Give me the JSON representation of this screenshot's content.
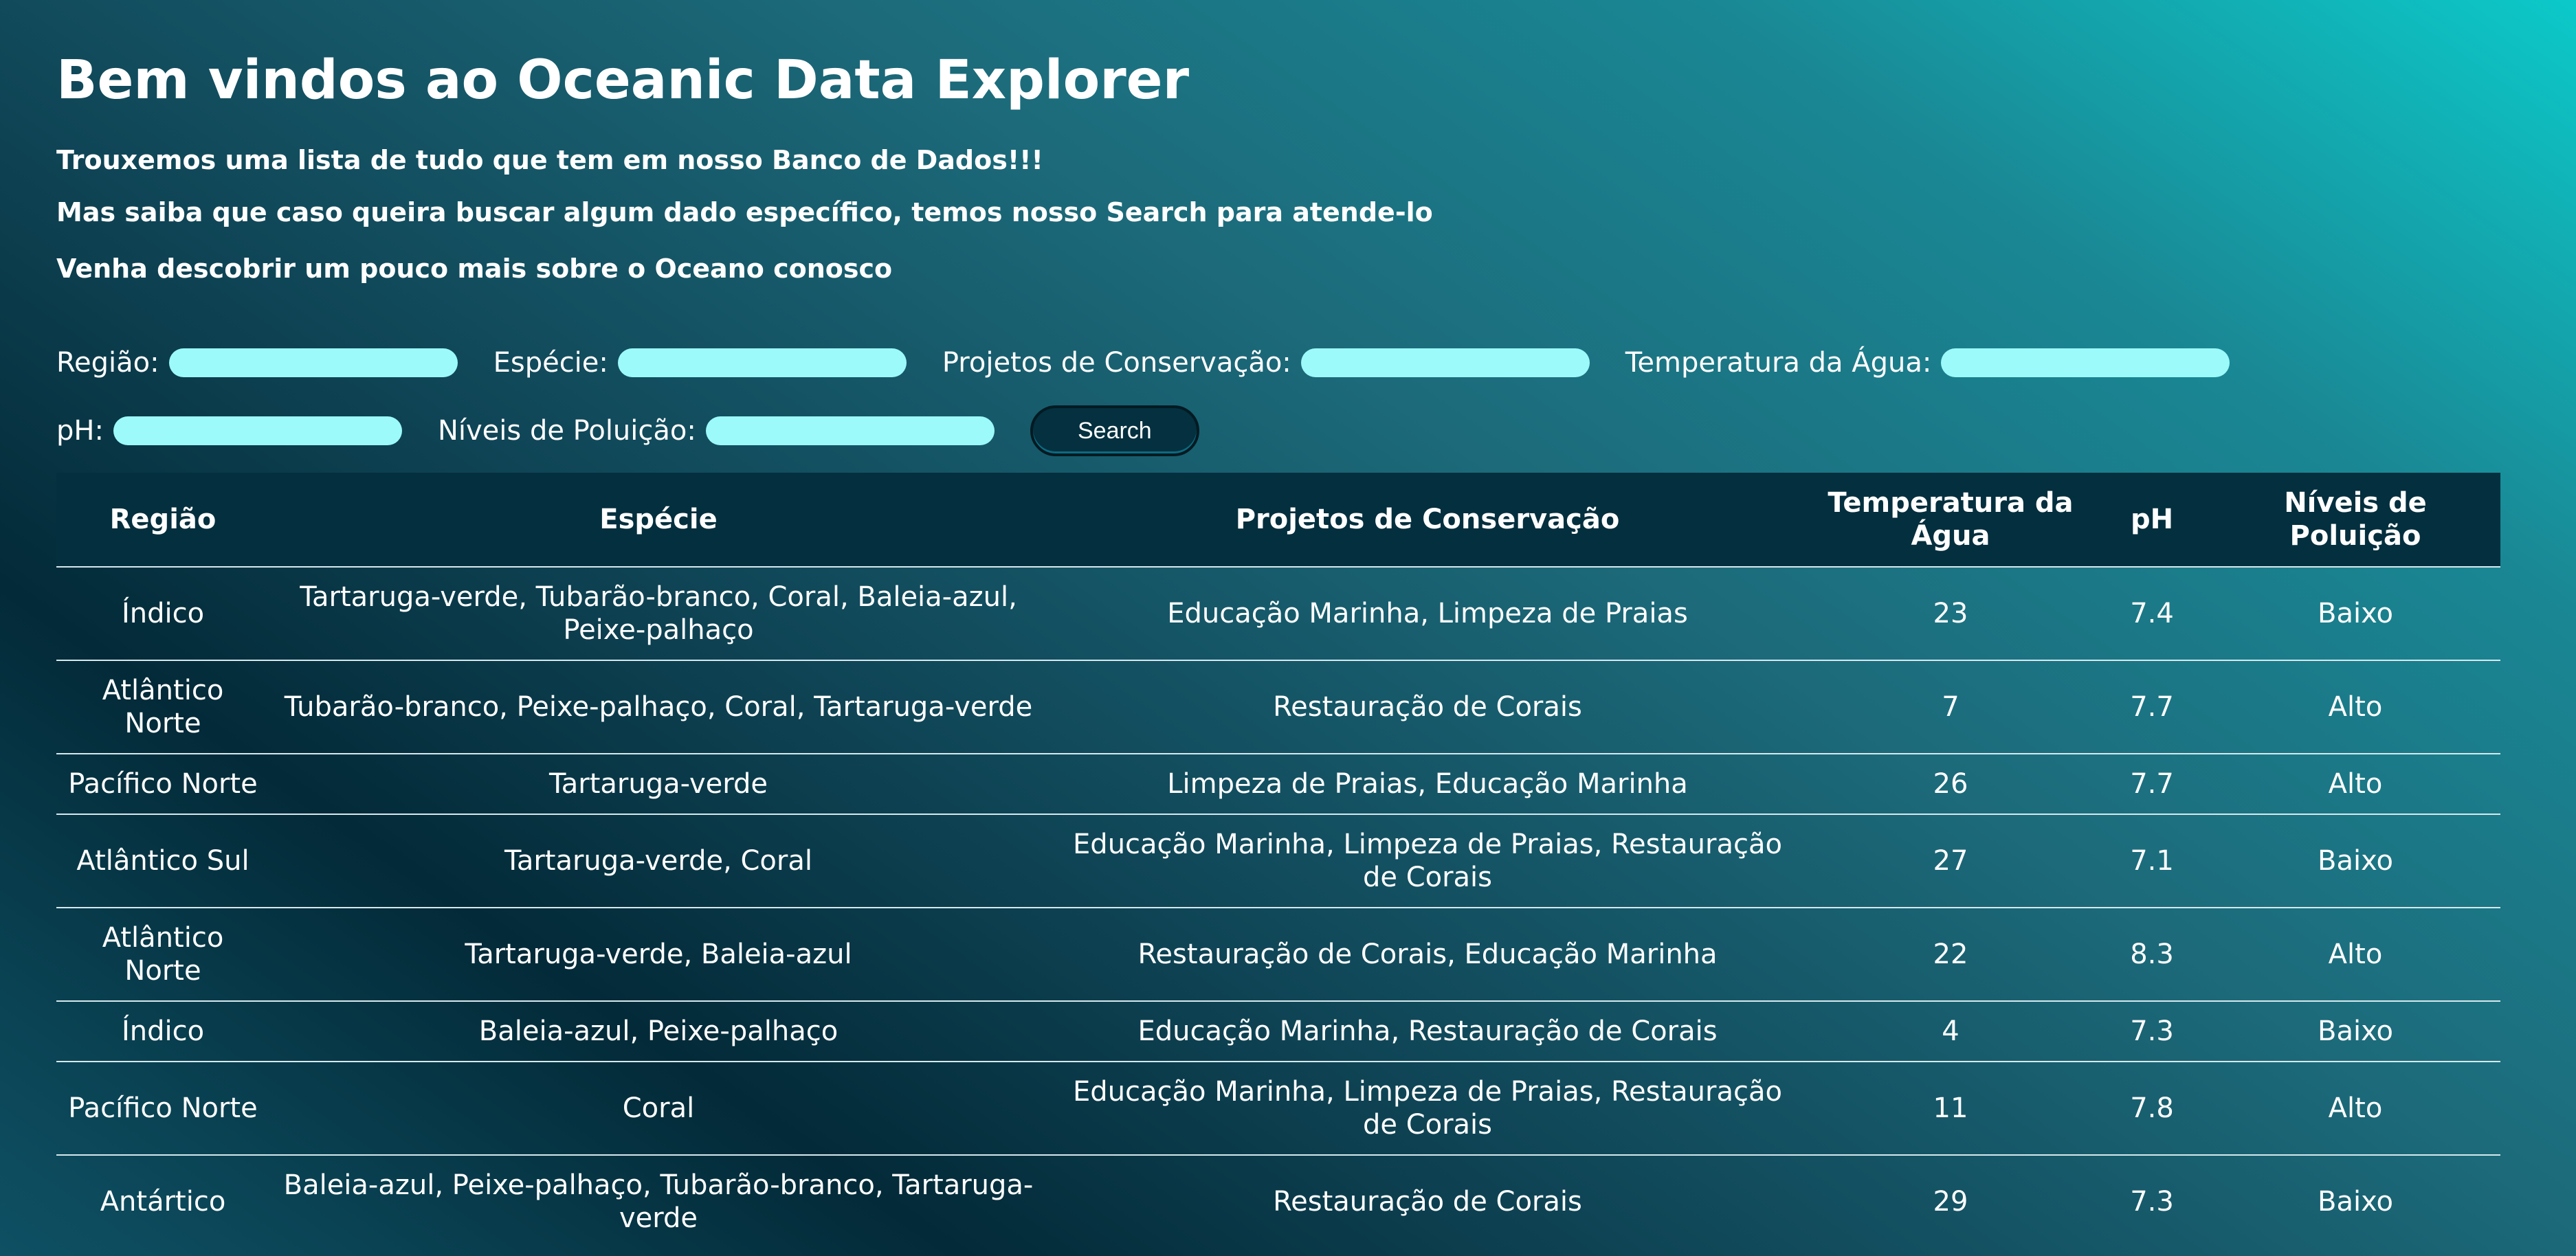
{
  "page": {
    "title": "Bem vindos ao Oceanic Data Explorer",
    "intro": [
      "Trouxemos uma lista de tudo que tem em nosso Banco de Dados!!!",
      "Mas saiba que caso queira buscar algum dado específico, temos nosso Search para atende-lo",
      "Venha descobrir um pouco mais sobre o Oceano conosco"
    ]
  },
  "filters": {
    "regiao_label": "Região:",
    "regiao_value": "",
    "especie_label": "Espécie:",
    "especie_value": "",
    "projetos_label": "Projetos de Conservação:",
    "projetos_value": "",
    "temperatura_label": "Temperatura da Água:",
    "temperatura_value": "",
    "ph_label": "pH:",
    "ph_value": "",
    "poluicao_label": "Níveis de Poluição:",
    "poluicao_value": "",
    "search_label": "Search"
  },
  "table": {
    "headers": [
      "Região",
      "Espécie",
      "Projetos de Conservação",
      "Temperatura da Água",
      "pH",
      "Níveis de Poluição"
    ],
    "rows": [
      [
        "Índico",
        "Tartaruga-verde, Tubarão-branco, Coral, Baleia-azul, Peixe-palhaço",
        "Educação Marinha, Limpeza de Praias",
        "23",
        "7.4",
        "Baixo"
      ],
      [
        "Atlântico Norte",
        "Tubarão-branco, Peixe-palhaço, Coral, Tartaruga-verde",
        "Restauração de Corais",
        "7",
        "7.7",
        "Alto"
      ],
      [
        "Pacífico Norte",
        "Tartaruga-verde",
        "Limpeza de Praias, Educação Marinha",
        "26",
        "7.7",
        "Alto"
      ],
      [
        "Atlântico Sul",
        "Tartaruga-verde, Coral",
        "Educação Marinha, Limpeza de Praias, Restauração de Corais",
        "27",
        "7.1",
        "Baixo"
      ],
      [
        "Atlântico Norte",
        "Tartaruga-verde, Baleia-azul",
        "Restauração de Corais, Educação Marinha",
        "22",
        "8.3",
        "Alto"
      ],
      [
        "Índico",
        "Baleia-azul, Peixe-palhaço",
        "Educação Marinha, Restauração de Corais",
        "4",
        "7.3",
        "Baixo"
      ],
      [
        "Pacífico Norte",
        "Coral",
        "Educação Marinha, Limpeza de Praias, Restauração de Corais",
        "11",
        "7.8",
        "Alto"
      ],
      [
        "Antártico",
        "Baleia-azul, Peixe-palhaço, Tubarão-branco, Tartaruga-verde",
        "Restauração de Corais",
        "29",
        "7.3",
        "Baixo"
      ]
    ]
  }
}
